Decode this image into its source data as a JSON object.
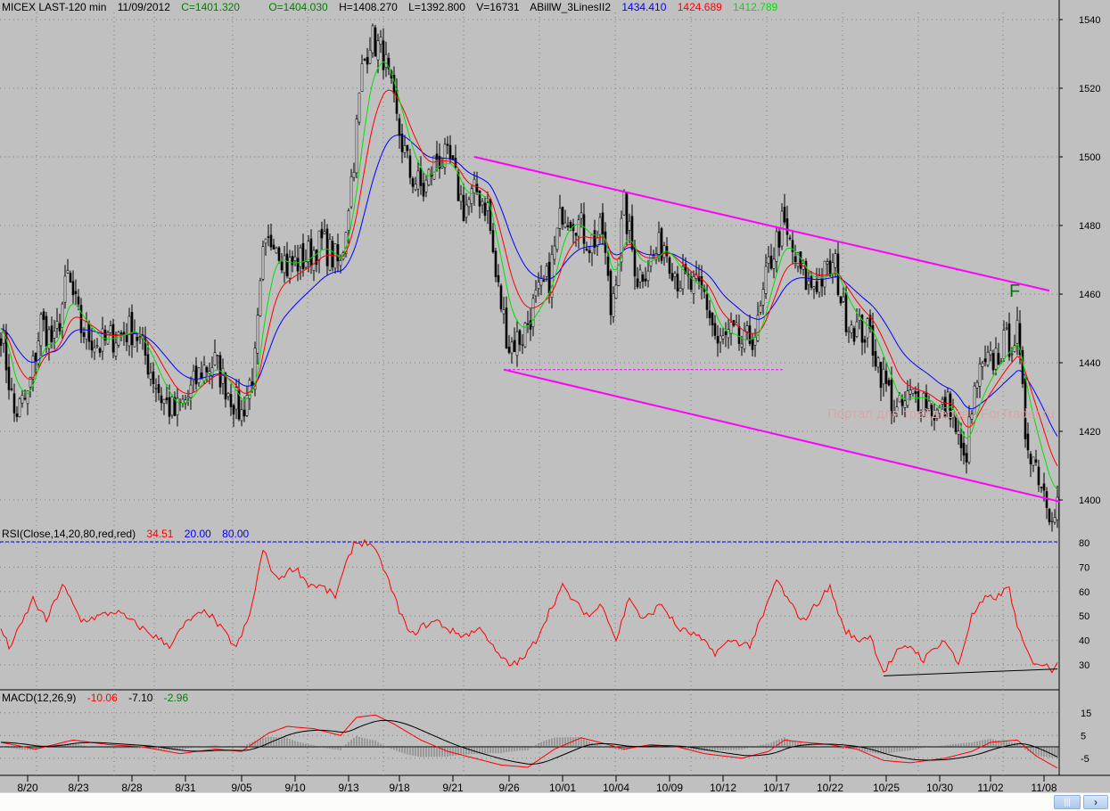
{
  "header": {
    "symbol": "MICEX LAST-120 min",
    "date": "11/09/2012",
    "close": "C=1401.320",
    "open": "O=1404.030",
    "high": "H=1408.270",
    "low": "L=1392.800",
    "volume": "V=16731",
    "indicator": "ABillW_3LinesII2",
    "line_blue": "1434.410",
    "line_red": "1424.689",
    "line_green": "1412.789"
  },
  "rsi_header": {
    "label": "RSI(Close,14,20,80,red,red)",
    "value": "34.51",
    "low": "20.00",
    "high": "80.00"
  },
  "macd_header": {
    "label": "MACD(12,26,9)",
    "macd": "-10.06",
    "signal": "-7.10",
    "hist": "-2.96"
  },
  "annotations": {
    "f_label": "F",
    "watermark": "Портал для трейдеров - ForTrader.ru"
  },
  "colors": {
    "background": "#c0c0c0",
    "blue": "#0000ff",
    "red": "#ff0000",
    "green": "#00e000",
    "trend": "#ff00ff"
  },
  "chart_data": [
    {
      "type": "candlestick",
      "title": "MICEX LAST-120 min",
      "ylim": [
        1390,
        1545
      ],
      "yticks": [
        1400,
        1420,
        1440,
        1460,
        1480,
        1500,
        1520,
        1540
      ],
      "xticks": [
        "8/20",
        "8/23",
        "8/28",
        "8/31",
        "9/05",
        "9/10",
        "9/13",
        "9/18",
        "9/21",
        "9/26",
        "10/01",
        "10/04",
        "10/09",
        "10/12",
        "10/17",
        "10/22",
        "10/25",
        "10/30",
        "11/02",
        "11/08"
      ],
      "xtick_bars": [
        10,
        29,
        49,
        69,
        90,
        110,
        130,
        149,
        169,
        190,
        210,
        230,
        250,
        270,
        290,
        310,
        331,
        351,
        370,
        390
      ],
      "bars": 396,
      "close_keypoints": [
        [
          0,
          1450
        ],
        [
          5,
          1425
        ],
        [
          10,
          1430
        ],
        [
          15,
          1452
        ],
        [
          20,
          1445
        ],
        [
          25,
          1465
        ],
        [
          30,
          1450
        ],
        [
          37,
          1445
        ],
        [
          43,
          1448
        ],
        [
          50,
          1450
        ],
        [
          55,
          1440
        ],
        [
          60,
          1430
        ],
        [
          65,
          1425
        ],
        [
          70,
          1430
        ],
        [
          75,
          1438
        ],
        [
          80,
          1440
        ],
        [
          85,
          1432
        ],
        [
          90,
          1425
        ],
        [
          95,
          1440
        ],
        [
          98,
          1470
        ],
        [
          102,
          1478
        ],
        [
          107,
          1468
        ],
        [
          113,
          1470
        ],
        [
          120,
          1475
        ],
        [
          127,
          1468
        ],
        [
          132,
          1500
        ],
        [
          135,
          1525
        ],
        [
          138,
          1535
        ],
        [
          143,
          1530
        ],
        [
          148,
          1510
        ],
        [
          153,
          1495
        ],
        [
          158,
          1490
        ],
        [
          163,
          1500
        ],
        [
          168,
          1498
        ],
        [
          173,
          1485
        ],
        [
          178,
          1490
        ],
        [
          182,
          1485
        ],
        [
          185,
          1465
        ],
        [
          190,
          1445
        ],
        [
          195,
          1448
        ],
        [
          200,
          1458
        ],
        [
          205,
          1465
        ],
        [
          210,
          1485
        ],
        [
          215,
          1482
        ],
        [
          220,
          1475
        ],
        [
          225,
          1478
        ],
        [
          228,
          1455
        ],
        [
          233,
          1485
        ],
        [
          238,
          1465
        ],
        [
          243,
          1470
        ],
        [
          248,
          1475
        ],
        [
          253,
          1465
        ],
        [
          258,
          1462
        ],
        [
          263,
          1460
        ],
        [
          268,
          1445
        ],
        [
          273,
          1448
        ],
        [
          278,
          1445
        ],
        [
          283,
          1450
        ],
        [
          287,
          1468
        ],
        [
          292,
          1480
        ],
        [
          297,
          1470
        ],
        [
          302,
          1462
        ],
        [
          307,
          1465
        ],
        [
          312,
          1468
        ],
        [
          315,
          1455
        ],
        [
          320,
          1450
        ],
        [
          325,
          1448
        ],
        [
          330,
          1435
        ],
        [
          335,
          1425
        ],
        [
          340,
          1430
        ],
        [
          345,
          1430
        ],
        [
          350,
          1425
        ],
        [
          355,
          1428
        ],
        [
          360,
          1410
        ],
        [
          365,
          1435
        ],
        [
          370,
          1440
        ],
        [
          375,
          1445
        ],
        [
          380,
          1448
        ],
        [
          383,
          1420
        ],
        [
          388,
          1408
        ],
        [
          392,
          1398
        ],
        [
          396,
          1400
        ]
      ],
      "moving_averages": [
        {
          "name": "blue",
          "period": 30
        },
        {
          "name": "red",
          "period": 15
        },
        {
          "name": "green",
          "period": 8
        }
      ],
      "trendlines": [
        {
          "name": "upper-channel",
          "from": [
            177,
            1500
          ],
          "to": [
            392,
            1461
          ]
        },
        {
          "name": "lower-channel",
          "from": [
            188,
            1438
          ],
          "to": [
            396,
            1399.5
          ]
        },
        {
          "name": "support-dashed",
          "from": [
            188,
            1438
          ],
          "to": [
            293,
            1438
          ]
        }
      ]
    },
    {
      "type": "line",
      "title": "RSI(Close,14,20,80,red,red)",
      "ylim": [
        20,
        85
      ],
      "yticks": [
        30,
        40,
        50,
        60,
        70,
        80
      ],
      "levels": [
        80
      ],
      "keypoints": [
        [
          0,
          45
        ],
        [
          3,
          37
        ],
        [
          7,
          45
        ],
        [
          12,
          57
        ],
        [
          17,
          48
        ],
        [
          23,
          63
        ],
        [
          30,
          48
        ],
        [
          37,
          50
        ],
        [
          43,
          52
        ],
        [
          50,
          47
        ],
        [
          57,
          42
        ],
        [
          63,
          38
        ],
        [
          70,
          48
        ],
        [
          77,
          52
        ],
        [
          83,
          44
        ],
        [
          88,
          37
        ],
        [
          93,
          50
        ],
        [
          98,
          77
        ],
        [
          103,
          65
        ],
        [
          110,
          70
        ],
        [
          115,
          63
        ],
        [
          120,
          62
        ],
        [
          125,
          58
        ],
        [
          132,
          80
        ],
        [
          138,
          80
        ],
        [
          143,
          70
        ],
        [
          148,
          55
        ],
        [
          153,
          42
        ],
        [
          158,
          46
        ],
        [
          163,
          48
        ],
        [
          168,
          44
        ],
        [
          173,
          42
        ],
        [
          180,
          45
        ],
        [
          185,
          35
        ],
        [
          190,
          30
        ],
        [
          195,
          32
        ],
        [
          200,
          40
        ],
        [
          205,
          52
        ],
        [
          210,
          62
        ],
        [
          215,
          55
        ],
        [
          220,
          50
        ],
        [
          225,
          55
        ],
        [
          230,
          40
        ],
        [
          235,
          58
        ],
        [
          240,
          48
        ],
        [
          247,
          55
        ],
        [
          253,
          45
        ],
        [
          260,
          42
        ],
        [
          267,
          35
        ],
        [
          273,
          40
        ],
        [
          280,
          38
        ],
        [
          285,
          50
        ],
        [
          290,
          65
        ],
        [
          295,
          55
        ],
        [
          300,
          48
        ],
        [
          305,
          55
        ],
        [
          310,
          62
        ],
        [
          315,
          45
        ],
        [
          320,
          40
        ],
        [
          325,
          42
        ],
        [
          330,
          27
        ],
        [
          335,
          35
        ],
        [
          340,
          38
        ],
        [
          345,
          32
        ],
        [
          350,
          38
        ],
        [
          353,
          40
        ],
        [
          358,
          30
        ],
        [
          363,
          50
        ],
        [
          368,
          57
        ],
        [
          373,
          58
        ],
        [
          377,
          62
        ],
        [
          380,
          45
        ],
        [
          385,
          32
        ],
        [
          390,
          30
        ],
        [
          393,
          28
        ],
        [
          396,
          34
        ]
      ],
      "trendline": {
        "from": [
          330,
          25.5
        ],
        "to": [
          395,
          28.3
        ]
      }
    },
    {
      "type": "line",
      "title": "MACD(12,26,9)",
      "ylim": [
        -12,
        20
      ],
      "yticks": [
        15,
        5,
        -5
      ],
      "macd_keypoints": [
        [
          0,
          2
        ],
        [
          13,
          -1
        ],
        [
          27,
          3
        ],
        [
          40,
          1
        ],
        [
          53,
          0
        ],
        [
          67,
          -3
        ],
        [
          80,
          -1
        ],
        [
          90,
          -2
        ],
        [
          100,
          6
        ],
        [
          107,
          9
        ],
        [
          117,
          8
        ],
        [
          127,
          5
        ],
        [
          133,
          13
        ],
        [
          140,
          14
        ],
        [
          147,
          10
        ],
        [
          157,
          3
        ],
        [
          167,
          -2
        ],
        [
          177,
          -5
        ],
        [
          187,
          -8
        ],
        [
          197,
          -9
        ],
        [
          207,
          -1
        ],
        [
          217,
          4
        ],
        [
          227,
          1
        ],
        [
          233,
          -1
        ],
        [
          243,
          1
        ],
        [
          253,
          0
        ],
        [
          263,
          -3
        ],
        [
          277,
          -5
        ],
        [
          287,
          -2
        ],
        [
          293,
          3
        ],
        [
          300,
          2
        ],
        [
          310,
          1
        ],
        [
          320,
          -1
        ],
        [
          330,
          -6
        ],
        [
          340,
          -7
        ],
        [
          353,
          -5
        ],
        [
          363,
          -2
        ],
        [
          370,
          2
        ],
        [
          380,
          3
        ],
        [
          387,
          -4
        ],
        [
          396,
          -10
        ]
      ],
      "signal_period_bars": 18
    }
  ]
}
